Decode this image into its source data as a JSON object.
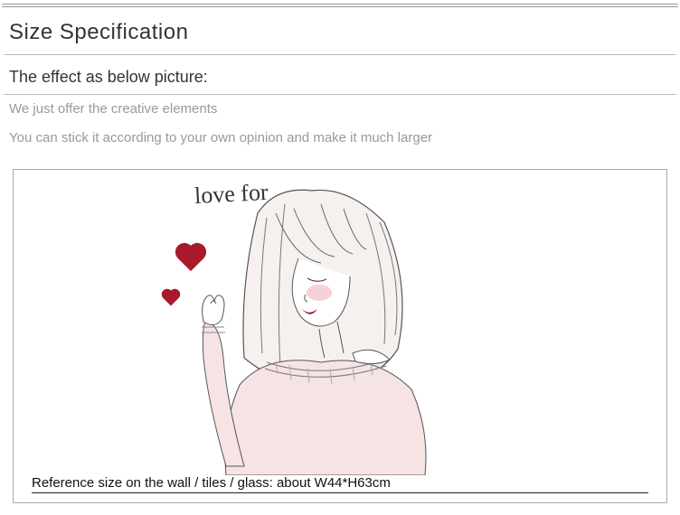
{
  "section_title": "Size Specification",
  "subtitle": "The effect as below picture:",
  "notes": {
    "line1": "We just offer the creative elements",
    "line2": "You can stick it according to your own opinion and make it much larger"
  },
  "illustration": {
    "script_text": "love for"
  },
  "reference_text": "Reference size on the wall / tiles / glass: about W44*H63cm"
}
